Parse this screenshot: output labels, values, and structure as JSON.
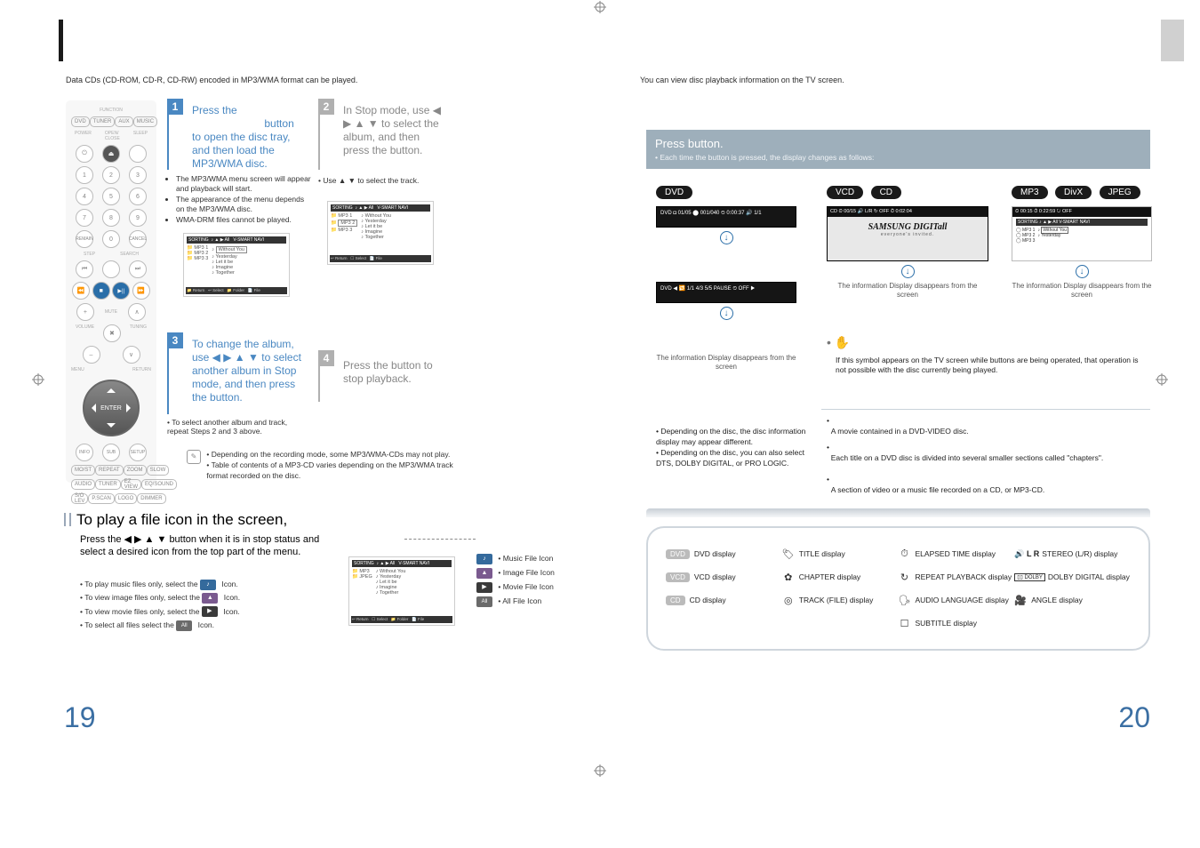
{
  "intro_left": "Data CDs (CD-ROM, CD-R, CD-RW) encoded in MP3/WMA format can be played.",
  "intro_right": "You can view disc playback information  on the TV screen.",
  "step1": {
    "head_a": "Press the",
    "head_b": "button to open the disc tray, and then load the MP3/WMA disc.",
    "bullets": [
      "The MP3/WMA menu screen will appear and playback will start.",
      "The appearance of the menu depends on the MP3/WMA disc.",
      "WMA-DRM files cannot be played."
    ]
  },
  "step2": {
    "head": "In Stop mode, use ◀ ▶ ▲ ▼ to select the album, and then press the button.",
    "bullet": "Use ▲ ▼ to select the track."
  },
  "step3": {
    "head": "To change the album, use ◀ ▶ ▲ ▼ to select another album in Stop mode, and then press the button.",
    "bullet": "To select another album and track, repeat Steps 2 and 3 above."
  },
  "step4": {
    "head": "Press the button to stop playback."
  },
  "notes": [
    "Depending on the recording mode, some MP3/WMA-CDs may not play.",
    "Table of contents of a MP3-CD varies depending on the MP3/WMA track format recorded on the disc."
  ],
  "section_title": "To play a file icon in the screen,",
  "section_body": "Press the ◀ ▶ ▲ ▼ button when it is in stop status and select a desired icon from the top part of the menu.",
  "section_bullets": [
    "To play music files only, select the",
    "To view image files only, select the",
    "To view movie files only, select the",
    "To select all files select the"
  ],
  "icon_suffix": "Icon.",
  "icon_list": [
    {
      "color": "#346a9c",
      "glyph": "♪",
      "label": "Music File Icon"
    },
    {
      "color": "#7a5a8f",
      "glyph": "▲",
      "label": "Image File Icon"
    },
    {
      "color": "#3a3a3a",
      "glyph": "▶",
      "label": "Movie File Icon"
    },
    {
      "color": "#6a6a6a",
      "glyph": "All",
      "label": "All File Icon"
    }
  ],
  "page_left": "19",
  "page_right": "20",
  "info_button": {
    "title": "Press        button.",
    "sub": "• Each time the button is pressed, the display changes as follows:"
  },
  "pills": {
    "dvd": "DVD",
    "vcd": "VCD",
    "cd": "CD",
    "mp3": "MP3",
    "divx": "DivX",
    "jpeg": "JPEG"
  },
  "thumb_dvd1": "DVD  ◘ 01/05  ⬤ 001/040  ⏲ 0:00:37  🔊 1/1",
  "thumb_dvd2": "DVD  ◀ 🔁 1/1  4/3 5/5  PAUSE   ⏲ OFF ▶",
  "thumb_vcd": "CD  ⏲ 00/15   🔊 L/R   ↻ OFF   ⏱ 0:02:04",
  "samsung": "SAMSUNG DIGITall",
  "samsung_sub": "everyone's invited.",
  "thumb_mp3_top": "⏲ 00:15     ⏱ 0:22:59     ↻ OFF",
  "thumb_mp3_sort": "SORTING   ♪  ▲  ▶  All   V-SMART NAVI",
  "cap_hide": "The information Display disappears from the screen",
  "sym_note": "If this symbol appears on the TV screen while buttons are being operated, that operation is not possible with the disc currently being played.",
  "term_title": "A movie contained in a DVD-VIDEO disc.",
  "term_chapter": "Each title on a DVD disc is divided into several smaller sections called \"chapters\".",
  "term_track": "A section of video or a music file recorded on a CD, or MP3-CD.",
  "dep1": "Depending on the disc, the disc information display may appear different.",
  "dep2": "Depending on the disc, you can also select DTS, DOLBY DIGITAL, or PRO LOGIC.",
  "gloss": [
    {
      "type": "badge",
      "bg": "#bbb",
      "t": "DVD",
      "label": "DVD display"
    },
    {
      "type": "ico",
      "g": "🏷",
      "label": "TITLE display"
    },
    {
      "type": "ico",
      "g": "⏱",
      "label": "ELAPSED TIME display"
    },
    {
      "type": "ico",
      "g": "🔊",
      "label": "STEREO (L/R) display"
    },
    {
      "type": "badge",
      "bg": "#bbb",
      "t": "VCD",
      "label": "VCD display"
    },
    {
      "type": "ico",
      "g": "✿",
      "label": "CHAPTER display"
    },
    {
      "type": "ico",
      "g": "↻",
      "label": "REPEAT PLAYBACK display"
    },
    {
      "type": "ico",
      "g": "▭",
      "label": "DOLBY DIGITAL display"
    },
    {
      "type": "badge",
      "bg": "#bbb",
      "t": "CD",
      "label": "CD display"
    },
    {
      "type": "ico",
      "g": "◎",
      "label": "TRACK (FILE) display"
    },
    {
      "type": "ico",
      "g": "🗣",
      "label": "AUDIO LANGUAGE display"
    },
    {
      "type": "ico",
      "g": "🎥",
      "label": "ANGLE display"
    },
    {
      "type": "blank"
    },
    {
      "type": "blank"
    },
    {
      "type": "ico",
      "g": "☐",
      "label": "SUBTITLE display"
    },
    {
      "type": "blank"
    }
  ],
  "mini_tracks": [
    "Without You",
    "Yesterday",
    "Let it be",
    "Imagine",
    "Together"
  ],
  "mini_folders": [
    "MP3 1",
    "MP3 2",
    "MP3 3"
  ],
  "dolby": "DOLBY",
  "lr": "L R"
}
